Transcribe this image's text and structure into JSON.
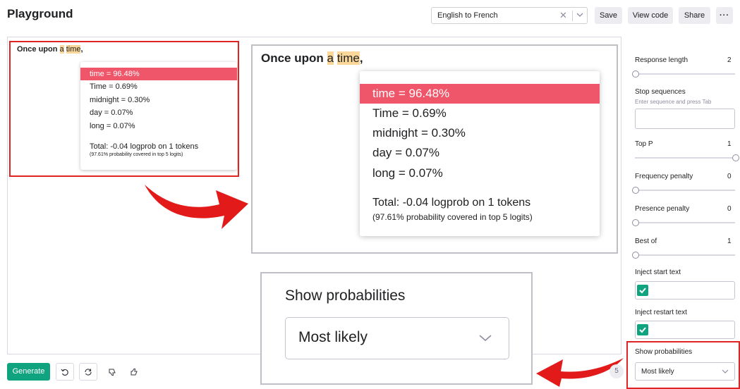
{
  "header": {
    "title": "Playground",
    "preset": "English to French",
    "clear_icon": "close-icon",
    "save_label": "Save",
    "view_code_label": "View code",
    "share_label": "Share",
    "more_label": "···"
  },
  "prompt": {
    "before": "Once upon ",
    "word_a": "a",
    "space": " ",
    "word_time": "time",
    "after": ","
  },
  "probabilities": {
    "items": [
      {
        "label": "time = 96.48%",
        "selected": true
      },
      {
        "label": "Time = 0.69%",
        "selected": false
      },
      {
        "label": "midnight = 0.30%",
        "selected": false
      },
      {
        "label": "day = 0.07%",
        "selected": false
      },
      {
        "label": "long = 0.07%",
        "selected": false
      }
    ],
    "total": "Total: -0.04 logprob on 1 tokens",
    "coverage": "(97.61% probability covered in top 5 logits)"
  },
  "zoom_show_probabilities": {
    "label": "Show probabilities",
    "value": "Most likely"
  },
  "footer": {
    "generate_label": "Generate",
    "undo_icon": "undo-icon",
    "regenerate_icon": "regenerate-icon",
    "thumbs_down_icon": "thumbs-down-icon",
    "thumbs_up_icon": "thumbs-up-icon",
    "token_count": "5"
  },
  "settings": {
    "response_length": {
      "label": "Response length",
      "value": "2",
      "level": 0.0
    },
    "stop_sequences": {
      "label": "Stop sequences",
      "hint": "Enter sequence and press Tab"
    },
    "top_p": {
      "label": "Top P",
      "value": "1",
      "level": 1.0
    },
    "frequency_penalty": {
      "label": "Frequency penalty",
      "value": "0",
      "level": 0.0
    },
    "presence_penalty": {
      "label": "Presence penalty",
      "value": "0",
      "level": 0.0
    },
    "best_of": {
      "label": "Best of",
      "value": "1",
      "level": 0.0
    },
    "inject_start_text": {
      "label": "Inject start text",
      "checked": true
    },
    "inject_restart_text": {
      "label": "Inject restart text",
      "checked": true
    },
    "show_probabilities": {
      "label": "Show probabilities",
      "value": "Most likely"
    }
  },
  "colors": {
    "accent": "#10a37f",
    "highlight": "#fbd79a",
    "selected_row": "#f0566a",
    "callout": "#e02424"
  }
}
